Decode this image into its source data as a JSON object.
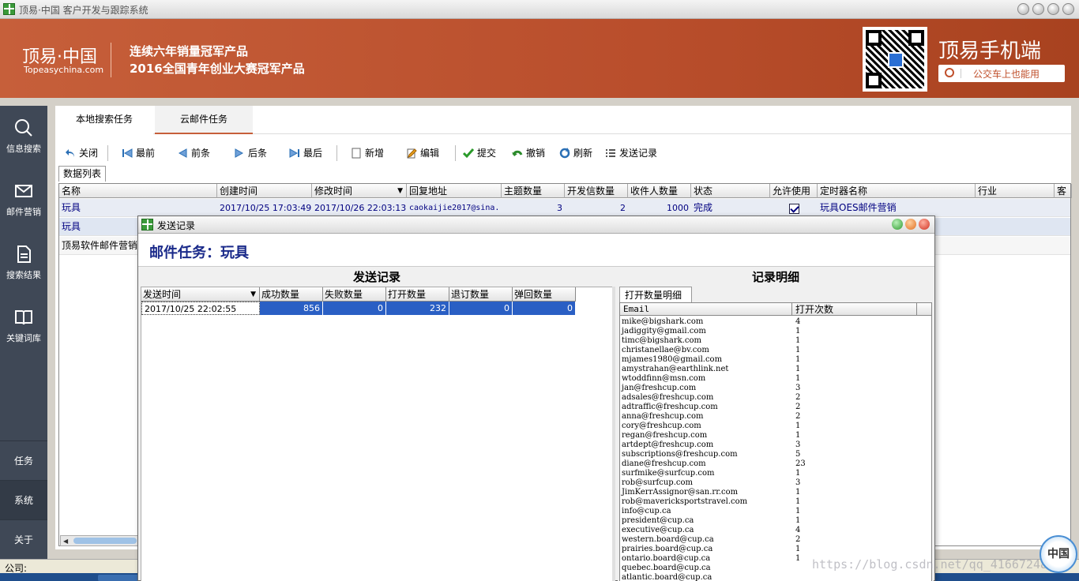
{
  "window": {
    "title": "顶易·中国 客户开发与跟踪系统"
  },
  "banner": {
    "logo_cn": "顶易·中国",
    "logo_en": "Topeasychina.com",
    "slogan_line1": "连续六年销量冠军产品",
    "slogan_line2": "2016全国青年创业大赛冠军产品",
    "mobile_title": "顶易手机端",
    "mobile_search": "公交车上也能用"
  },
  "sidebar": {
    "items": [
      {
        "label": "信息搜索",
        "icon": "search-icon"
      },
      {
        "label": "邮件营销",
        "icon": "mail-icon"
      },
      {
        "label": "搜索结果",
        "icon": "document-icon"
      },
      {
        "label": "关键词库",
        "icon": "book-icon"
      }
    ],
    "bottom": [
      "任务",
      "系统",
      "关于"
    ]
  },
  "tabs": [
    "本地搜索任务",
    "云邮件任务"
  ],
  "toolbar": [
    "关闭",
    "最前",
    "前条",
    "后条",
    "最后",
    "新增",
    "编辑",
    "提交",
    "撤销",
    "刷新",
    "发送记录"
  ],
  "list_tab": "数据列表",
  "grid": {
    "columns": [
      "名称",
      "创建时间",
      "修改时间",
      "回复地址",
      "主题数量",
      "开发信数量",
      "收件人数量",
      "状态",
      "允许使用",
      "定时器名称",
      "行业",
      "客"
    ],
    "rows": [
      {
        "name": "玩具",
        "created": "2017/10/25 17:03:49",
        "modified": "2017/10/26 22:03:13",
        "reply": "caokaijie2017@sina.",
        "topics": "3",
        "letters": "2",
        "recipients": "1000",
        "status": "完成",
        "allowed": true,
        "timer": "玩具OES邮件营销"
      },
      {
        "name": "玩具"
      },
      {
        "name": "顶易软件邮件营销"
      }
    ]
  },
  "statusbar": {
    "company_label": "公司:"
  },
  "dialog": {
    "title": "发送记录",
    "task_label": "邮件任务：玩具",
    "left_title": "发送记录",
    "right_title": "记录明细",
    "columns": [
      "发送时间",
      "成功数量",
      "失败数量",
      "打开数量",
      "退订数量",
      "弹回数量"
    ],
    "row": [
      "2017/10/25 22:02:55",
      "856",
      "0",
      "232",
      "0",
      "0"
    ],
    "detail_tab": "打开数量明细",
    "detail_columns": [
      "Email",
      "打开次数"
    ],
    "details": [
      [
        "mike@bigshark.com",
        "4"
      ],
      [
        "jadiggity@gmail.com",
        "1"
      ],
      [
        "timc@bigshark.com",
        "1"
      ],
      [
        "christanellae@bv.com",
        "1"
      ],
      [
        "mjames1980@gmail.com",
        "1"
      ],
      [
        "amystrahan@earthlink.net",
        "1"
      ],
      [
        "wtoddfinn@msn.com",
        "1"
      ],
      [
        "jan@freshcup.com",
        "3"
      ],
      [
        "adsales@freshcup.com",
        "2"
      ],
      [
        "adtraffic@freshcup.com",
        "2"
      ],
      [
        "anna@freshcup.com",
        "2"
      ],
      [
        "cory@freshcup.com",
        "1"
      ],
      [
        "regan@freshcup.com",
        "1"
      ],
      [
        "artdept@freshcup.com",
        "3"
      ],
      [
        "subscriptions@freshcup.com",
        "5"
      ],
      [
        "diane@freshcup.com",
        "23"
      ],
      [
        "surfmike@surfcup.com",
        "1"
      ],
      [
        "rob@surfcup.com",
        "3"
      ],
      [
        "JimKerrAssignor@san.rr.com",
        "1"
      ],
      [
        "rob@mavericksportstravel.com",
        "1"
      ],
      [
        "info@cup.ca",
        "1"
      ],
      [
        "president@cup.ca",
        "1"
      ],
      [
        "executive@cup.ca",
        "4"
      ],
      [
        "western.board@cup.ca",
        "2"
      ],
      [
        "prairies.board@cup.ca",
        "1"
      ],
      [
        "ontario.board@cup.ca",
        "1"
      ],
      [
        "quebec.board@cup.ca",
        ""
      ],
      [
        "atlantic.board@cup.ca",
        ""
      ]
    ]
  },
  "watermark": "https://blog.csdn.net/qq_41667248",
  "seal_text": "中国"
}
